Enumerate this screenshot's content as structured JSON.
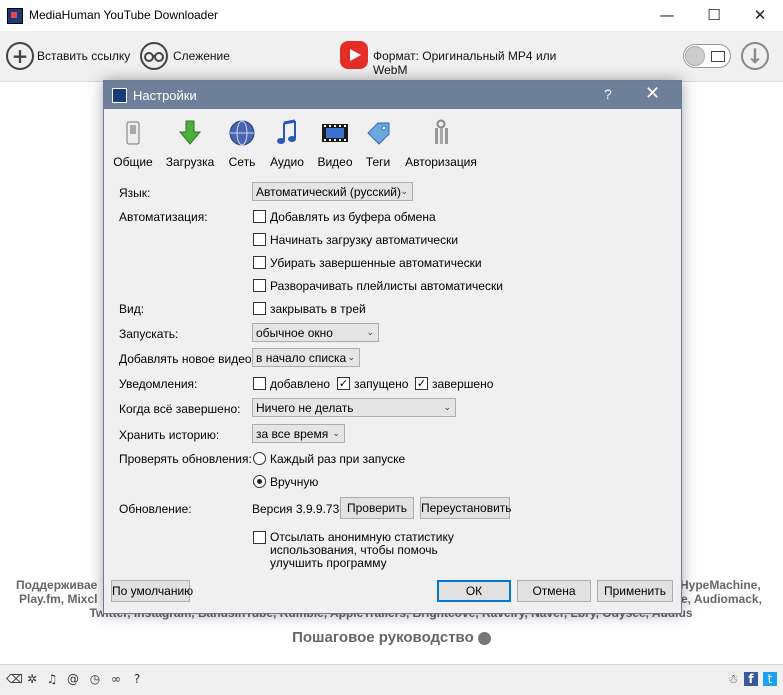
{
  "app": {
    "title": "MediaHuman YouTube Downloader"
  },
  "window_controls": {
    "minimize": "—",
    "maximize": "☐",
    "close": "✕"
  },
  "toolbar": {
    "paste_label": "Вставить ссылку",
    "tracking_label": "Слежение",
    "format_label": "Формат: Оригинальный MP4 или WebM"
  },
  "background": {
    "supported_left": "Поддерживае",
    "supported_right": "HypeMachine,",
    "line2_left": "Play.fm, Mixcl",
    "line2_right": "e, Audiomack,",
    "line3": "Twitter, Instagram, BandsInTube, Rumble, AppleTrailers, Brightcove, Ravelry, Naver, Lbry, Odysee, Audius",
    "guide": "Пошаговое руководство"
  },
  "dialog": {
    "title": "Настройки",
    "help": "?",
    "close": "✕",
    "tabs": [
      {
        "label": "Общие",
        "icon": "switch-icon"
      },
      {
        "label": "Загрузка",
        "icon": "download-arrow-icon"
      },
      {
        "label": "Сеть",
        "icon": "globe-icon"
      },
      {
        "label": "Аудио",
        "icon": "music-note-icon"
      },
      {
        "label": "Видео",
        "icon": "film-strip-icon"
      },
      {
        "label": "Теги",
        "icon": "tag-icon"
      },
      {
        "label": "Авторизация",
        "icon": "keys-icon"
      }
    ],
    "language": {
      "label": "Язык:",
      "value": "Автоматический (русский)"
    },
    "automation": {
      "label": "Автоматизация:",
      "options": [
        {
          "text": "Добавлять из буфера обмена",
          "checked": false
        },
        {
          "text": "Начинать загрузку автоматически",
          "checked": false
        },
        {
          "text": "Убирать завершенные автоматически",
          "checked": false
        },
        {
          "text": "Разворачивать плейлисты автоматически",
          "checked": false
        }
      ]
    },
    "view": {
      "label": "Вид:",
      "option": "закрывать в трей",
      "checked": false
    },
    "launch": {
      "label": "Запускать:",
      "value": "обычное окно"
    },
    "add_video": {
      "label": "Добавлять новое видео:",
      "value": "в начало списка"
    },
    "notifications": {
      "label": "Уведомления:",
      "added": "добавлено",
      "added_checked": false,
      "started": "запущено",
      "started_checked": true,
      "finished": "завершено",
      "finished_checked": true,
      "check_mark": "✓"
    },
    "when_done": {
      "label": "Когда всё завершено:",
      "value": "Ничего не делать"
    },
    "history": {
      "label": "Хранить историю:",
      "value": "за все время"
    },
    "updates": {
      "label": "Проверять обновления:",
      "option1": "Каждый раз при запуске",
      "option2": "Вручную",
      "selected": "Вручную"
    },
    "update": {
      "label": "Обновление:",
      "version": "Версия 3.9.9.73",
      "check_button": "Проверить",
      "reinstall_button": "Переустановить"
    },
    "stats": {
      "line1": "Отсылать анонимную статистику",
      "line2": "использования, чтобы помочь",
      "line3": "улучшить программу",
      "checked": false
    },
    "buttons": {
      "defaults": "По умолчанию",
      "ok": "ОК",
      "cancel": "Отмена",
      "apply": "Применить"
    }
  },
  "colors": {
    "dialog_title": "#6d7f99",
    "youtube_red": "#e52d27",
    "default_button_border": "#0078d7"
  }
}
